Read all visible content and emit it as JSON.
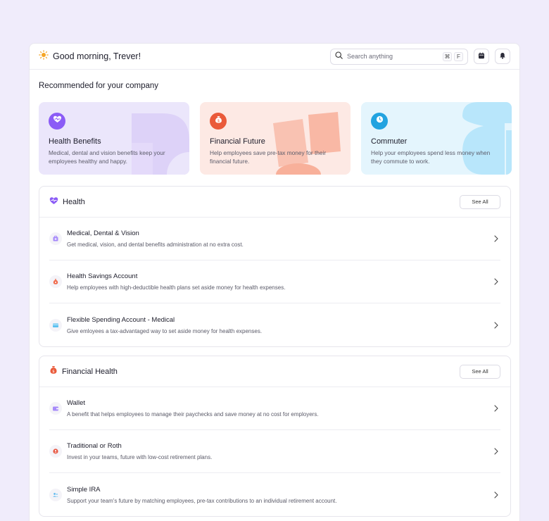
{
  "header": {
    "greeting": "Good morning, Trever!",
    "search_placeholder": "Search anything",
    "shortcut_keys": [
      "⌘",
      "F"
    ]
  },
  "recommended": {
    "title": "Recommended for your company",
    "cards": [
      {
        "title": "Health Benefits",
        "desc": "Medical, dental and vision benefits keep your employees healthy and happy.",
        "color": "#8b5cf6"
      },
      {
        "title": "Financial Future",
        "desc": "Help employees save pre-tax money for their financial future.",
        "color": "#ea5a3a"
      },
      {
        "title": "Commuter",
        "desc": "Help your employees spend less money when they commute to work.",
        "color": "#22a3e0"
      }
    ]
  },
  "groups": [
    {
      "title": "Health",
      "see_all": "See All",
      "items": [
        {
          "title": "Medical, Dental & Vision",
          "desc": "Get medical, vision, and dental benefits administration at no extra cost."
        },
        {
          "title": "Health Savings Account",
          "desc": "Help employees with high-deductible health plans set aside money for health expenses."
        },
        {
          "title": "Flexible Spending Account - Medical",
          "desc": "Give emloyees a tax-advantaged way to set aside money for health expenses."
        }
      ]
    },
    {
      "title": "Financial Health",
      "see_all": "See All",
      "items": [
        {
          "title": "Wallet",
          "desc": "A benefit that helps employees to manage their paychecks and save money at no cost for employers."
        },
        {
          "title": "Traditional or Roth",
          "desc": "Invest in your teams, future with low-cost retirement plans."
        },
        {
          "title": "Simple IRA",
          "desc": "Support your team's future by matching employees, pre-tax contributions to an individual retirement account."
        }
      ]
    }
  ]
}
